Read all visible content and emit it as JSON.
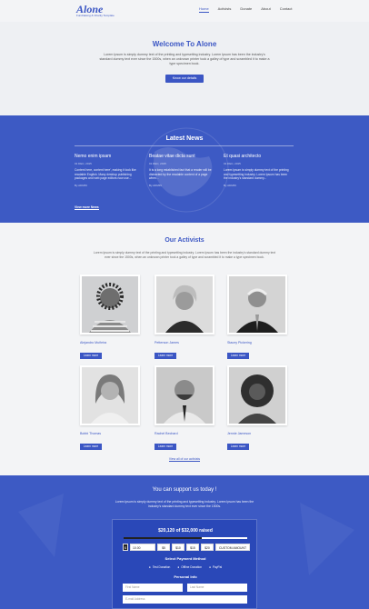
{
  "header": {
    "logo": "Alone",
    "logo_tagline": "Fundraising & Charity Template",
    "nav": [
      "Home",
      "Activists",
      "Donate",
      "About",
      "Contact"
    ],
    "active_nav": "Home"
  },
  "hero": {
    "title": "Welcome To Alone",
    "text": "Lorem Ipsum is simply dummy text of the printing and typesetting industry. Lorem Ipsum has been the industry's standard dummy text ever since the 1500s, when an unknown printer took a galley of type and scrambled it to make a type specimen book.",
    "button": "Know our details"
  },
  "news": {
    "title": "Latest News",
    "items": [
      {
        "title": "Nemo enim ipsam",
        "date": "01 DEC, 2015",
        "text": "Content here, content here', making it look like readable English. Many desktop publishing packages and web page editors now use...",
        "author": "By ADMIN"
      },
      {
        "title": "Beatae vitae dicta sunt",
        "date": "01 DEC, 2015",
        "text": "It is a long established fact that a reader will be distracted by the readable content of a page when...",
        "author": "By ADMIN"
      },
      {
        "title": "Et quasi architecto",
        "date": "01 DEC, 2015",
        "text": "Lorem Ipsum is simply dummy text of the printing and typesetting industry. Lorem Ipsum has been the industry's standard dummy...",
        "author": "By ADMIN"
      }
    ],
    "more_link": "View more News"
  },
  "activists": {
    "title": "Our Activists",
    "text": "Lorem Ipsum is simply dummy text of the printing and typesetting industry. Lorem Ipsum has been the industry's standard dummy text ever since the 1500s, when an unknown printer took a galley of type and scrambled it to make a type specimen book.",
    "people": [
      {
        "name": "Alejandro Muñeira",
        "button": "Learn more"
      },
      {
        "name": "Petterson James",
        "button": "Learn more"
      },
      {
        "name": "Stacey Pickering",
        "button": "Learn more"
      },
      {
        "name": "Bobbi Thomas",
        "button": "Learn more"
      },
      {
        "name": "Rachel Bechard",
        "button": "Learn more"
      },
      {
        "name": "Jennie Jameson",
        "button": "Learn more"
      }
    ],
    "view_all": "View all of our activists"
  },
  "support": {
    "title": "You can support us today !",
    "text": "Lorem Ipsum is simply dummy text of the printing and typesetting industry. Lorem Ipsum has been the industry's standard dummy text ever since the 1500s.",
    "raised_text": "$20,120 of $32,000 raised",
    "raised_fraction": 0.63,
    "currency": "$",
    "amounts": [
      "10.00",
      "$5",
      "$10",
      "$15",
      "$20"
    ],
    "custom_amount": "CUSTOM AMOUNT",
    "payment_title": "Select Payment Method",
    "payment_methods": [
      "Test Donation",
      "Offline Donation",
      "PayPal"
    ],
    "personal_title": "Personal Info",
    "first_name_placeholder": "First Name",
    "last_name_placeholder": "Last Name",
    "email_placeholder": "E-mail Address"
  },
  "colors": {
    "primary": "#3d5ac4",
    "background": "#f3f4f6"
  }
}
